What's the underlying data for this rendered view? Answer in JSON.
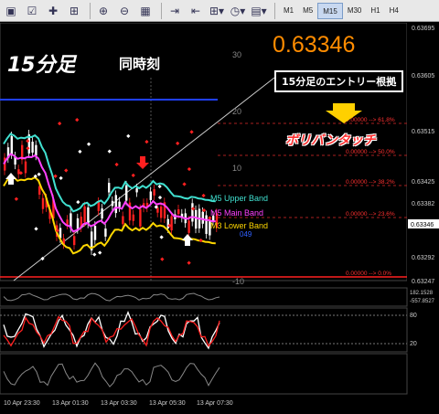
{
  "toolbar": {
    "buttons": [
      "new-chart",
      "profiles",
      "navigator",
      "terminal",
      "tester",
      "zoom-in",
      "zoom-out",
      "tile",
      "chart-shift",
      "auto-scroll",
      "indicators",
      "periods",
      "templates"
    ],
    "timeframes": [
      "M1",
      "M5",
      "M15",
      "M30",
      "H1",
      "H4"
    ],
    "active_timeframe": "M15"
  },
  "overlay": {
    "title": "15分足",
    "subtitle": "同時刻",
    "price_big": "0.63346",
    "callout": "15分足のエントリー根拠",
    "arrow_label": "ボリバンタッチ"
  },
  "price_axis": {
    "labels": [
      "0.63695",
      "0.63605",
      "0.63515",
      "0.63425",
      "0.63382",
      "0.63346",
      "0.63292",
      "0.63247"
    ],
    "current": "0.63346"
  },
  "fib_levels": [
    {
      "label": "0.00000 --> 38.2%"
    },
    {
      "label": "0.00000 --> 23.6%"
    },
    {
      "label": "0.00000 --> 0.0%"
    },
    {
      "label": "0.00000 --> 50.0%"
    },
    {
      "label": "0.00000 --> 61.8%"
    }
  ],
  "band_labels": {
    "upper": "M5 Upper Band",
    "main": "M5 Main Band",
    "lower": "M3 Lower Band",
    "extra": "049"
  },
  "left_axis": [
    "30",
    "20",
    "10",
    "-10"
  ],
  "sub1_labels": [
    "182.1528",
    "-557.8527"
  ],
  "sub2_labels": [
    "80",
    "20"
  ],
  "time_axis": [
    "10 Apr 23:30",
    "13 Apr 01:30",
    "13 Apr 03:30",
    "13 Apr 05:30",
    "13 Apr 07:30"
  ],
  "colors": {
    "upper_band": "#40e0d0",
    "main_band": "#ff40ff",
    "lower_band": "#ffd700",
    "bull": "#ffffff",
    "bear": "#ff2020",
    "fib": "#ff3030",
    "callout_bg": "#000000",
    "arrow": "#ffd000"
  }
}
